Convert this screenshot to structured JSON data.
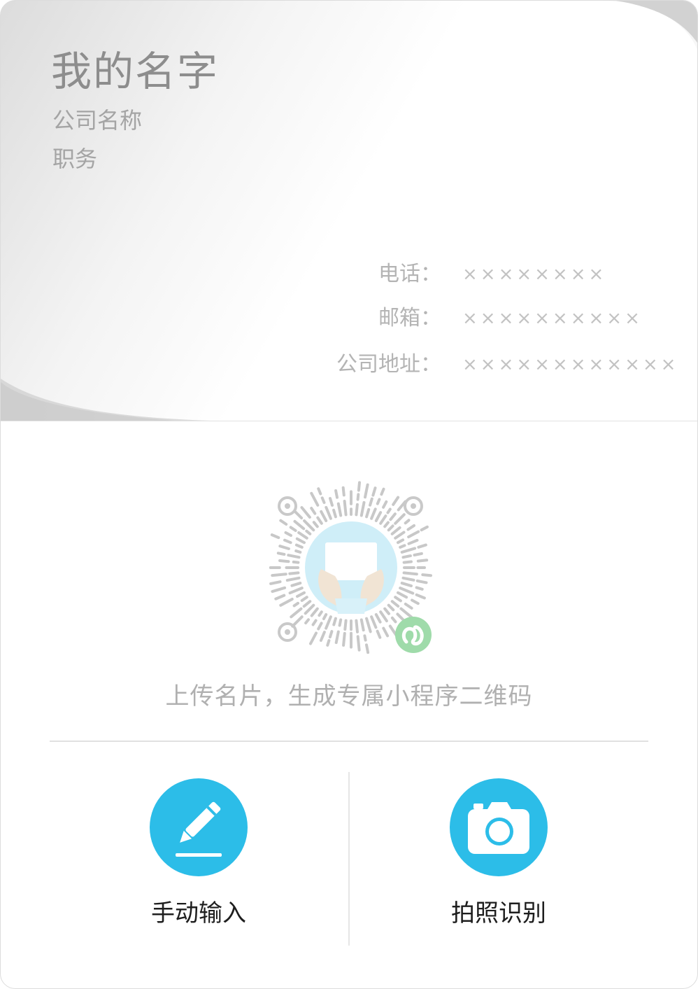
{
  "card": {
    "name": "我的名字",
    "company": "公司名称",
    "title": "职务",
    "fields": [
      {
        "label": "电话：",
        "value": "××××××××"
      },
      {
        "label": "邮箱：",
        "value": "××××××××××"
      },
      {
        "label": "公司地址：",
        "value": "××××××××××××"
      }
    ]
  },
  "qr": {
    "icon": "mini-program-qr-code"
  },
  "hint": "上传名片，生成专属小程序二维码",
  "actions": {
    "manual": {
      "label": "手动输入",
      "icon": "pencil-icon"
    },
    "photo": {
      "label": "拍照识别",
      "icon": "camera-icon"
    }
  },
  "colors": {
    "accent": "#2cbde8",
    "label_text": "#1e1e1e",
    "hint_text": "#b0b0b0",
    "mini_program_badge": "#7ccf8a"
  }
}
